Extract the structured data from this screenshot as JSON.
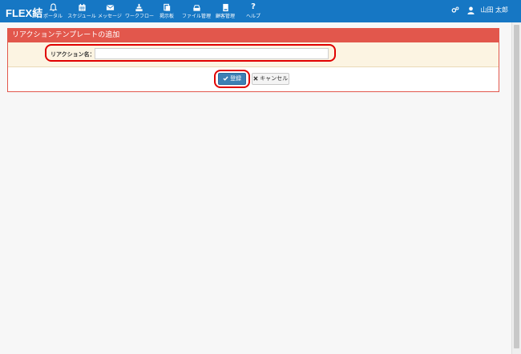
{
  "app": {
    "logo": "FLEX結"
  },
  "nav": [
    {
      "label": "ポータル",
      "icon": "bell-icon"
    },
    {
      "label": "スケジュール",
      "icon": "calendar-icon"
    },
    {
      "label": "メッセージ",
      "icon": "envelope-icon"
    },
    {
      "label": "ワークフロー",
      "icon": "workflow-icon"
    },
    {
      "label": "掲示板",
      "icon": "bulletin-icon"
    },
    {
      "label": "ファイル管理",
      "icon": "file-drive-icon"
    },
    {
      "label": "顧客管理",
      "icon": "customer-icon"
    },
    {
      "label": "ヘルプ",
      "icon": "question-icon"
    }
  ],
  "user": {
    "name": "山田 太郎"
  },
  "form": {
    "title": "リアクションテンプレートの追加",
    "field_label": "リアクション名：",
    "input_value": "",
    "register_label": "登録",
    "cancel_label": "キャンセル"
  },
  "colors": {
    "topbar": "#1677c4",
    "panel_header": "#e2574c",
    "form_row": "#fcf4e2",
    "primary_button": "#3d7fb4",
    "highlight": "#e00000"
  }
}
